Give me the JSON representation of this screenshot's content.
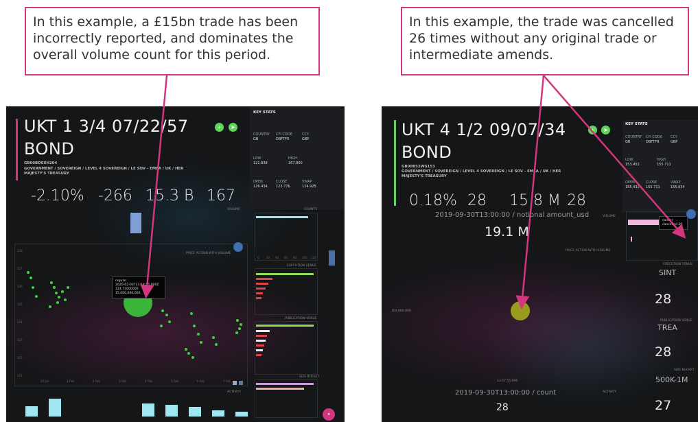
{
  "callouts": {
    "left": "In this example, a £15bn trade has been incorrectly reported, and  dominates the overall volume count for this period.",
    "right": "In this example, the trade was cancelled 26 times without any original trade or intermediate amends."
  },
  "left_panel": {
    "title_line1": "UKT 1 3/4 07/22/57",
    "title_line2": "BOND",
    "isin": "GB00BD0XH204",
    "category_line1": "GOVERNMENT / SOVEREIGN / LEVEL 4 SOVEREIGN / LE SOV - EMEA / UK / HER",
    "category_line2": "MAJESTY'S TREASURY",
    "metrics": [
      "-2.10%",
      "-266",
      "15.3 B",
      "167"
    ],
    "key_stats": {
      "title": "KEY STATS",
      "cells": [
        {
          "label": "COUNTRY",
          "value": "GB"
        },
        {
          "label": "CFI CODE",
          "value": "DBFTFR"
        },
        {
          "label": "CCY",
          "value": "GBP"
        },
        {
          "label": "LOW",
          "value": "121.838"
        },
        {
          "label": "HIGH",
          "value": "167.800"
        },
        {
          "label": "OPEN",
          "value": "126.434"
        },
        {
          "label": "CLOSE",
          "value": "123.776"
        },
        {
          "label": "VWAP",
          "value": "124.925"
        }
      ]
    },
    "section_labels": {
      "volume": "VOLUME",
      "price_action": "PRICE ACTION WITH VOLUME",
      "counts": "COUNTS",
      "execution_venue": "EXECUTION VENUE",
      "publication_venue": "PUBLICATION VENUE",
      "size_bucket": "SIZE BUCKET",
      "activity": "ACTIVITY"
    },
    "tooltip_lines": [
      "regular",
      "2020-02-03T13:14:55.000Z",
      "124.73000000",
      "15,000,000,000"
    ],
    "y_ticks": [
      "128",
      "127",
      "126",
      "125",
      "124",
      "123",
      "122",
      "121"
    ],
    "x_ticks": [
      "05 Jan",
      "1 Feb",
      "2 Feb",
      "3 Feb",
      "4 Feb",
      "5 Feb",
      "6 Feb",
      "7 Feb"
    ],
    "counts_ticks": [
      "0",
      "20",
      "40",
      "60",
      "80",
      "100",
      "120"
    ],
    "activity_values": [
      0.45,
      0.75,
      0.0,
      0.0,
      0.0,
      0.55,
      0.5,
      0.4,
      0.25,
      0.2
    ]
  },
  "right_panel": {
    "title_line1": "UKT 4 1/2 09/07/34",
    "title_line2": "BOND",
    "isin": "GB00B52WS153",
    "category_line1": "GOVERNMENT / SOVEREIGN / LEVEL 4 SOVEREIGN / LE SOV - EMEA / UK / HER",
    "category_line2": "MAJESTY'S TREASURY",
    "metrics": [
      "0.18%",
      "28",
      "15.8 M",
      "28"
    ],
    "key_stats": {
      "title": "KEY STATS",
      "cells": [
        {
          "label": "COUNTRY",
          "value": "GB"
        },
        {
          "label": "CFI CODE",
          "value": "DBFTFR"
        },
        {
          "label": "CCY",
          "value": "GBP"
        },
        {
          "label": "LOW",
          "value": "153.452"
        },
        {
          "label": "HIGH",
          "value": "155.711"
        },
        {
          "label": "OPEN",
          "value": "155.432"
        },
        {
          "label": "CLOSE",
          "value": "155.711"
        },
        {
          "label": "VWAP",
          "value": "155.634"
        }
      ]
    },
    "notional_caption": "2019-09-30T13:00:00 / notional amount_usd",
    "notional_value": "19.1 M",
    "count_caption": "2019-09-30T13:00:00 / count",
    "count_value": "28",
    "price_action_label": "PRICE ACTION WITH VOLUME",
    "volume_label": "VOLUME",
    "activity_label": "ACTIVITY",
    "tooltip_lines": [
      "cancel",
      "cancelled 26"
    ],
    "x_axis_label": "13:57:55.000",
    "y_axis_label": "154.600.000",
    "side_labels": {
      "execution_venue": "EXECUTION VENUE",
      "publication_venue": "PUBLICATION VENUE",
      "size_bucket": "SIZE BUCKET"
    },
    "side_values": {
      "execution_venue": "SINT",
      "execution_count": "28",
      "publication_venue": "TREA",
      "publication_count": "28",
      "size_bucket": "500K-1M",
      "size_count": "27"
    }
  },
  "colors": {
    "accent_pink": "#d2367f",
    "green": "#5fd35a",
    "cyan": "#9fe7f0",
    "red_bar": "#d44",
    "olive_bubble": "#9a9a1e"
  }
}
